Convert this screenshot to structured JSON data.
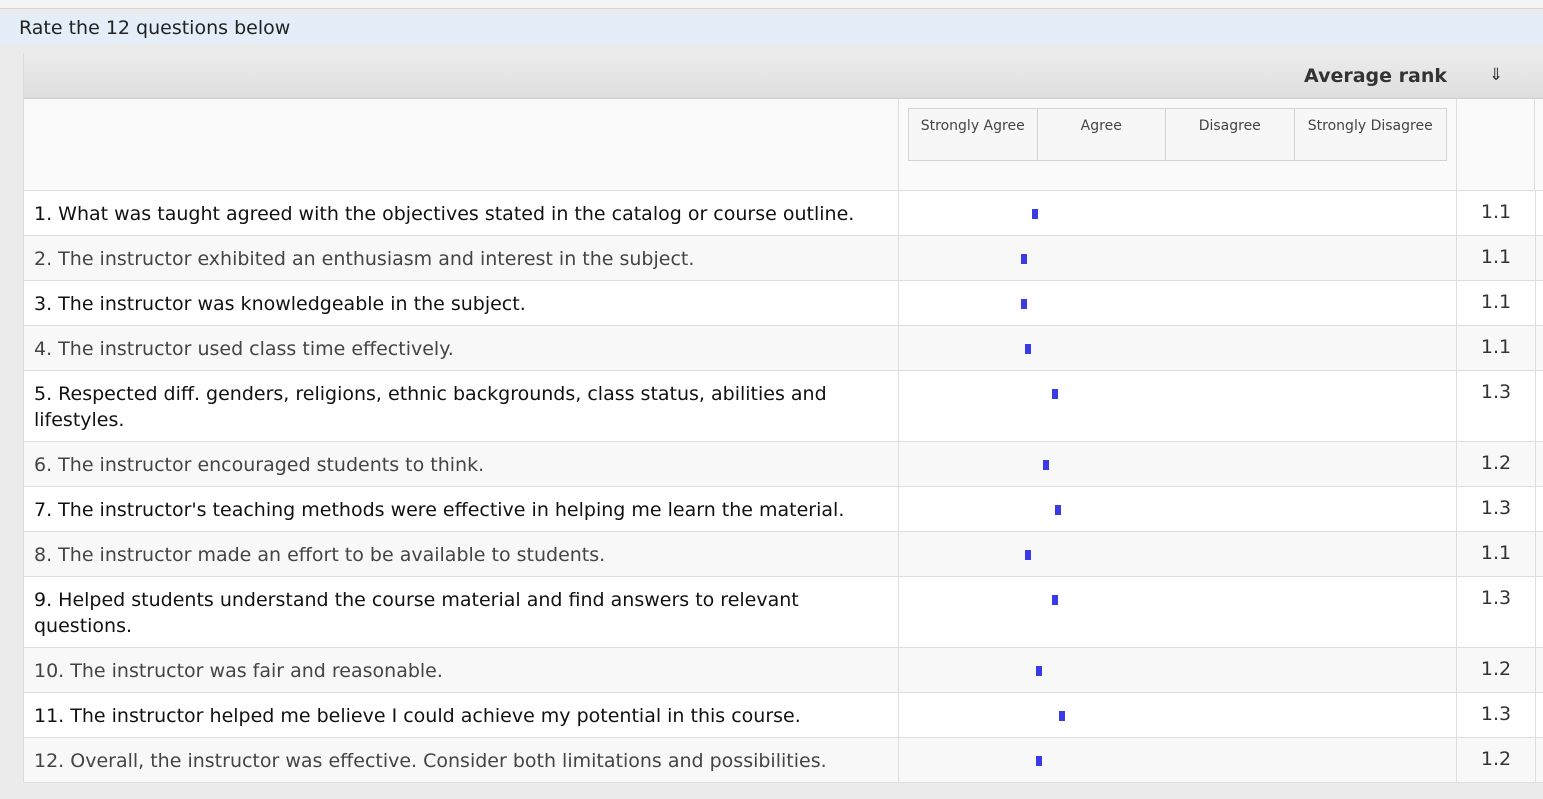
{
  "header": {
    "title": "Rate the 12 questions below"
  },
  "table": {
    "average_label": "Average rank",
    "sort_icon": "⇓",
    "scale_labels": [
      "Strongly Agree",
      "Agree",
      "Disagree",
      "Strongly Disagree"
    ],
    "scale_min": 1,
    "scale_max": 4,
    "marker_color": "#3a3ae8",
    "rows": [
      {
        "question": "1. What was taught agreed with the objectives stated in the catalog or course outline.",
        "average": "1.1",
        "value": 1.14
      },
      {
        "question": "2. The instructor exhibited an enthusiasm and interest in the subject.",
        "average": "1.1",
        "value": 1.08
      },
      {
        "question": "3. The instructor was knowledgeable in the subject.",
        "average": "1.1",
        "value": 1.08
      },
      {
        "question": "4. The instructor used class time effectively.",
        "average": "1.1",
        "value": 1.1
      },
      {
        "question": "5. Respected diff. genders, religions, ethnic backgrounds, class status, abilities and lifestyles.",
        "average": "1.3",
        "value": 1.25
      },
      {
        "question": "6. The instructor encouraged students to think.",
        "average": "1.2",
        "value": 1.2
      },
      {
        "question": "7. The instructor's teaching methods were effective in helping me learn the material.",
        "average": "1.3",
        "value": 1.27
      },
      {
        "question": "8. The instructor made an effort to be available to students.",
        "average": "1.1",
        "value": 1.1
      },
      {
        "question": "9. Helped students understand the course material and find answers to relevant questions.",
        "average": "1.3",
        "value": 1.25
      },
      {
        "question": "10. The instructor was fair and reasonable.",
        "average": "1.2",
        "value": 1.16
      },
      {
        "question": "11. The instructor helped me believe I could achieve my potential in this course.",
        "average": "1.3",
        "value": 1.29
      },
      {
        "question": "12. Overall, the instructor was effective. Consider both limitations and possibilities.",
        "average": "1.2",
        "value": 1.16
      }
    ]
  }
}
